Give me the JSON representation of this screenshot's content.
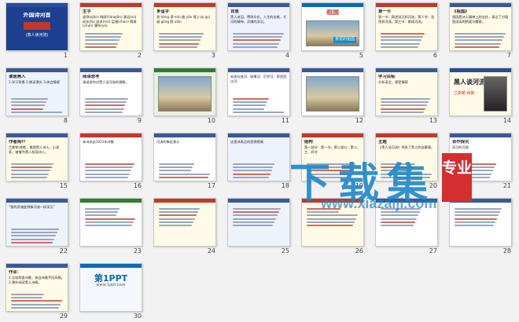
{
  "slides": [
    {
      "n": "1",
      "bar": "#2a4a9a",
      "bg": "#1d3f8f",
      "title": "外国诗河首",
      "text": "(真人读河流)",
      "kind": "cover"
    },
    {
      "n": "2",
      "bar": "#c0392b",
      "bg": "#fffbe6",
      "title": "生字",
      "text": "虚弥(qiān) 瑞丽(hǎnqiān) 源远(sù) 成长(fǔ) 追求(mǔ) 臣服(chún) 溯源(chún) 瀑布(yǔ)",
      "kind": "text"
    },
    {
      "n": "3",
      "bar": "#c0392b",
      "bg": "#fffbe6",
      "title": "多音字",
      "text": "弦 hóng 谬 mǐu 殷 yān 锲 ji 纠 guǐ 谐 gǒng 鲜 xiān",
      "kind": "text"
    },
    {
      "n": "4",
      "bar": "#3b5998",
      "bg": "#eef3fb",
      "title": "背景",
      "text": "黑人流泪，博采众长，人生的苦难，大河的精神，灵魂的深沉。",
      "kind": "text"
    },
    {
      "n": "5",
      "bar": "#0b6bb0",
      "bg": "#ffffff",
      "title": "祖国",
      "text": "亲爱的祖国",
      "kind": "photo"
    },
    {
      "n": "6",
      "bar": "#c0392b",
      "bg": "#fffbe6",
      "title": "第一节",
      "text": "第一节：叙述深沉如河流，第二节：浩荡如河流，第三节：歌颂河流。",
      "kind": "text"
    },
    {
      "n": "7",
      "bar": "#3b5998",
      "bg": "#fffbe6",
      "title": "《祖国》",
      "text": "祖国是诗人精神上的支柱，表达了对祖国深深的热爱与敬意。",
      "kind": "text"
    },
    {
      "n": "8",
      "bar": "#3b5998",
      "bg": "#eef3fb",
      "title": "谁是黑人",
      "text": "1.学习背景 2.朗读课文 3.体会情感",
      "kind": "text"
    },
    {
      "n": "9",
      "bar": "#3b5998",
      "bg": "#ffffff",
      "title": "阅读思考",
      "text": "请说说你对黑人谈河流的理解。",
      "kind": "text"
    },
    {
      "n": "10",
      "bar": "#2e7d32",
      "bg": "#e8f0e0",
      "title": "",
      "text": "",
      "kind": "photo"
    },
    {
      "n": "11",
      "bar": "#3b5998",
      "bg": "#ffffff",
      "title": "",
      "text": "幼发拉底河、刚果河、尼罗河、密西西比河",
      "kind": "text"
    },
    {
      "n": "12",
      "bar": "#3b5998",
      "bg": "#ffffff",
      "title": "",
      "text": "",
      "kind": "photo"
    },
    {
      "n": "13",
      "bar": "#3b5998",
      "bg": "#fffbe6",
      "title": "学习目标",
      "text": "分析语言，感受情感",
      "kind": "text"
    },
    {
      "n": "14",
      "bar": "#2a4a9a",
      "bg": "#fffbe6",
      "title": "黑人谈河流",
      "text": "兰斯顿·休斯",
      "kind": "portrait"
    },
    {
      "n": "15",
      "bar": "#3b5998",
      "bg": "#fffbe6",
      "title": "作者简介",
      "text": "兰斯顿·休斯，美国黑人诗人，小说家，被誉为黑人桂冠诗人。",
      "kind": "text"
    },
    {
      "n": "16",
      "bar": "#c0392b",
      "bg": "#ffffff",
      "title": "",
      "text": "本诗选自1921年诗集",
      "kind": "text"
    },
    {
      "n": "17",
      "bar": "#3b5998",
      "bg": "#ffffff",
      "title": "",
      "text": "河流的象征意义",
      "kind": "text"
    },
    {
      "n": "18",
      "bar": "#3b5998",
      "bg": "#eef3fb",
      "title": "",
      "text": "这首诗表达的思想感情",
      "kind": "text"
    },
    {
      "n": "19",
      "bar": "#c0392b",
      "bg": "#fffbe6",
      "title": "结构",
      "text": "第一部分：第一节，第二部分：第二、三、四节",
      "kind": "text"
    },
    {
      "n": "20",
      "bar": "#c0392b",
      "bg": "#fffbe6",
      "title": "主题",
      "text": "《黑人谈河流》抒发了黑人的自豪感。",
      "kind": "text"
    },
    {
      "n": "21",
      "bar": "#3b5998",
      "bg": "#ffffff",
      "title": "合作探究",
      "text": "深沉的河流",
      "kind": "text"
    },
    {
      "n": "22",
      "bar": "#3b5998",
      "bg": "#eef3fb",
      "title": "",
      "text": "“我的灵魂变得像河流一样深沉”",
      "kind": "text"
    },
    {
      "n": "23",
      "bar": "#2e7d32",
      "bg": "#ffffff",
      "title": "",
      "text": "",
      "kind": "text"
    },
    {
      "n": "24",
      "bar": "#c0392b",
      "bg": "#fffbe6",
      "title": "",
      "text": "",
      "kind": "text"
    },
    {
      "n": "25",
      "bar": "#3b5998",
      "bg": "#eef3fb",
      "title": "",
      "text": "",
      "kind": "text"
    },
    {
      "n": "26",
      "bar": "#c0392b",
      "bg": "#fffbe6",
      "title": "",
      "text": "",
      "kind": "text"
    },
    {
      "n": "27",
      "bar": "#3b5998",
      "bg": "#ffffff",
      "title": "",
      "text": "",
      "kind": "text"
    },
    {
      "n": "28",
      "bar": "#3b5998",
      "bg": "#ffffff",
      "title": "",
      "text": "",
      "kind": "text"
    },
    {
      "n": "29",
      "bar": "#3b5998",
      "bg": "#fffbe6",
      "title": "作业：",
      "text": "1.比较两首诗歌，体会诗歌不同风格。2.课外阅读黑人诗歌。",
      "kind": "text"
    },
    {
      "n": "30",
      "bar": "#0b6bb0",
      "bg": "#f4f8fc",
      "title": "第1PPT",
      "text": "www.1ppt.com",
      "kind": "logo"
    }
  ],
  "watermark": {
    "title": "下载集",
    "url": "www.xiazaiji.com",
    "badge": "专业"
  },
  "colors": {
    "accent": "#1e88c9",
    "badge": "#d32f2f"
  }
}
